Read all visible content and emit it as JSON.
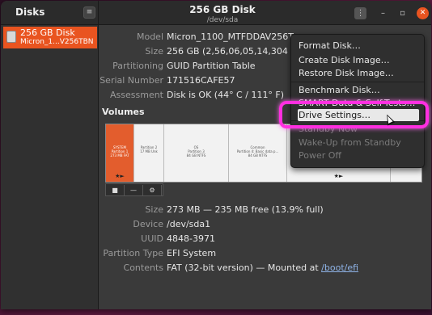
{
  "app": {
    "title": "Disks",
    "hamburger_icon": "hamburger-icon"
  },
  "header": {
    "title": "256 GB Disk",
    "subtitle": "/dev/sda",
    "menu_icon": "vertical-dots-icon",
    "min_icon": "minimize-icon",
    "max_icon": "maximize-icon",
    "close_icon": "close-icon"
  },
  "sidebar": {
    "items": [
      {
        "label": "256 GB Disk",
        "sublabel": "Micron_1...V256TBN",
        "selected": true,
        "icon": "drive-icon"
      }
    ]
  },
  "drive": {
    "model_label": "Model",
    "model_value": "Micron_1100_MTFDDAV256T",
    "size_label": "Size",
    "size_value": "256 GB (2,56,06,05,14,304 b",
    "partitioning_label": "Partitioning",
    "partitioning_value": "GUID Partition Table",
    "serial_label": "Serial Number",
    "serial_value": "171516CAFE57",
    "assessment_label": "Assessment",
    "assessment_value": "Disk is OK (44° C / 111° F)"
  },
  "volumes": {
    "title": "Volumes",
    "partitions": [
      {
        "lines": [
          "SYSTEM",
          "Partition 1",
          "273 MB FAT"
        ],
        "selected": true,
        "marker": "★►"
      },
      {
        "lines": [
          "Partition 2",
          "17 MB Unk"
        ],
        "selected": false,
        "marker": ""
      },
      {
        "lines": [
          "OS",
          "Partition 3",
          "84 GB NTFS"
        ],
        "selected": false,
        "marker": ""
      },
      {
        "lines": [
          "Common",
          "Partition 4: Basic data p...",
          "84 GB NTFS"
        ],
        "selected": false,
        "marker": ""
      },
      {
        "lines": [
          ""
        ],
        "selected": false,
        "marker": "★►"
      },
      {
        "lines": [
          ""
        ],
        "selected": false,
        "marker": ""
      }
    ],
    "toolbar": [
      {
        "glyph": "■",
        "icon": "stop-icon"
      },
      {
        "glyph": "—",
        "icon": "minus-icon"
      },
      {
        "glyph": "⚙",
        "icon": "gears-icon"
      }
    ]
  },
  "volume_props": {
    "size_label": "Size",
    "size_value": "273 MB — 235 MB free (13.9% full)",
    "device_label": "Device",
    "device_value": "/dev/sda1",
    "uuid_label": "UUID",
    "uuid_value": "4848-3971",
    "ptype_label": "Partition Type",
    "ptype_value": "EFI System",
    "contents_label": "Contents",
    "contents_value": "FAT (32-bit version) — Mounted at ",
    "contents_link": "/boot/efi"
  },
  "menu": {
    "items": [
      {
        "label": "Format Disk…",
        "enabled": true
      },
      {
        "label": "Create Disk Image…",
        "enabled": true
      },
      {
        "label": "Restore Disk Image…",
        "enabled": true
      },
      {
        "label": "Benchmark Disk…",
        "enabled": true
      },
      {
        "label": "SMART Data & Self-Tests…",
        "enabled": true
      },
      {
        "label": "Drive Settings…",
        "enabled": true,
        "hover": true
      },
      {
        "label": "Standby Now",
        "enabled": false
      },
      {
        "label": "Wake-Up from Standby",
        "enabled": false
      },
      {
        "label": "Power Off",
        "enabled": false
      }
    ]
  },
  "colors": {
    "accent": "#e95420",
    "highlight_ring": "#ff2fe0"
  }
}
